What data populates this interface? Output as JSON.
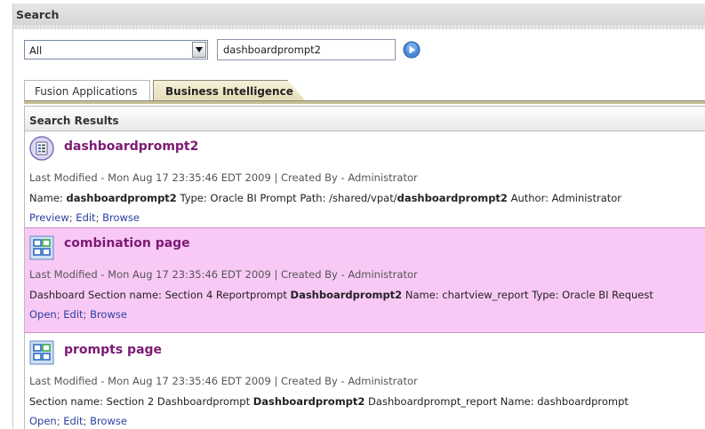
{
  "header": {
    "title": "Search"
  },
  "search": {
    "scope_value": "All",
    "query_value": "dashboardprompt2"
  },
  "tabs": [
    {
      "label": "Fusion Applications",
      "active": false
    },
    {
      "label": "Business Intelligence",
      "active": true
    }
  ],
  "results": {
    "header": "Search Results",
    "items": [
      {
        "icon": "prompt-icon",
        "title": "dashboardprompt2",
        "meta": "Last Modified - Mon Aug 17 23:35:46 EDT 2009 | Created By - Administrator",
        "desc": [
          {
            "t": "Name: ",
            "b": false
          },
          {
            "t": "dashboardprompt2",
            "b": true
          },
          {
            "t": " Type: Oracle BI Prompt Path: /shared/vpat/",
            "b": false
          },
          {
            "t": "dashboardprompt2",
            "b": true
          },
          {
            "t": " Author: Administrator",
            "b": false
          }
        ],
        "links": [
          "Preview",
          "Edit",
          "Browse"
        ],
        "highlighted": false
      },
      {
        "icon": "dashboard-page-icon",
        "title": "combination page",
        "meta": "Last Modified - Mon Aug 17 23:35:46 EDT 2009 | Created By - Administrator",
        "desc": [
          {
            "t": "Dashboard Section name: Section 4 Reportprompt ",
            "b": false
          },
          {
            "t": "Dashboardprompt2",
            "b": true
          },
          {
            "t": " Name: chartview_report Type: Oracle BI Request",
            "b": false
          }
        ],
        "links": [
          "Open",
          "Edit",
          "Browse"
        ],
        "highlighted": true
      },
      {
        "icon": "dashboard-page-icon",
        "title": "prompts page",
        "meta": "Last Modified - Mon Aug 17 23:35:46 EDT 2009 | Created By - Administrator",
        "desc": [
          {
            "t": "Section name: Section 2 Dashboardprompt ",
            "b": false
          },
          {
            "t": "Dashboardprompt2",
            "b": true
          },
          {
            "t": " Dashboardprompt_report Name: dashboardprompt",
            "b": false
          }
        ],
        "links": [
          "Open",
          "Edit",
          "Browse"
        ],
        "highlighted": false
      }
    ]
  }
}
